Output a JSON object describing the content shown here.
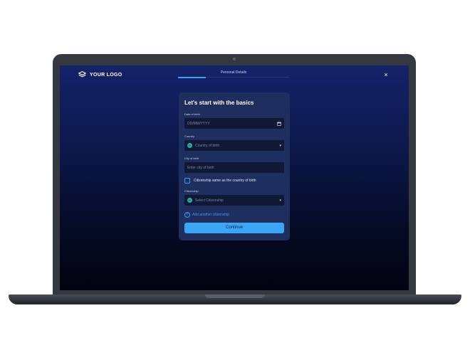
{
  "header": {
    "logo_text": "YOUR LOGO",
    "step_label": "Personal Details",
    "progress_fraction": 0.25,
    "close_icon": "×"
  },
  "form": {
    "title": "Let's start with the basics",
    "date_of_birth": {
      "label": "Date of birth",
      "placeholder": "DD/MM/YYYY"
    },
    "country": {
      "label": "Country",
      "placeholder": "Country of birth"
    },
    "city_of_birth": {
      "label": "City of birth",
      "placeholder": "Enter city of birth"
    },
    "citizenship_same": {
      "label": "Citizenship same as the country of birth",
      "checked": false
    },
    "citizenship": {
      "label": "Citizenship",
      "placeholder": "Select Citizenship"
    },
    "add_citizenship_label": "Add another citizenship",
    "continue_label": "Continue"
  },
  "colors": {
    "accent": "#3aa6f5",
    "card": "#1e2e5e",
    "field": "#0f1834",
    "screen_top": "#142369",
    "screen_bottom": "#020410"
  },
  "icons": {
    "logo": "cube-logo-icon",
    "calendar": "calendar-icon",
    "globe": "globe-flag-icon",
    "chevron": "chevron-down-icon",
    "plus": "plus-circle-icon"
  }
}
